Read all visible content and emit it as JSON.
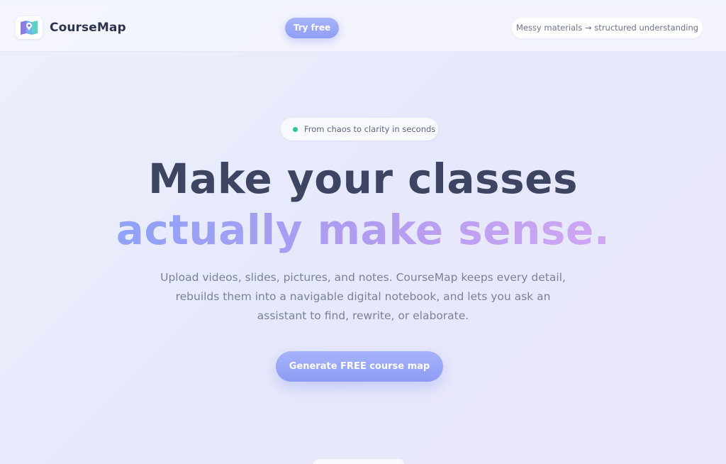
{
  "header": {
    "brand": "CourseMap",
    "try_button": "Try free",
    "tagline": "Messy materials → structured understanding",
    "logo_icon": "map-pin-icon"
  },
  "hero": {
    "badge": "From chaos to clarity in seconds",
    "headline_line1": "Make your classes",
    "headline_line2": "actually make sense.",
    "subtext": "Upload videos, slides, pictures, and notes. CourseMap keeps every detail, rebuilds them into a navigable digital notebook, and lets you ask an assistant to find, rewrite, or elaborate.",
    "cta": "Generate FREE course map"
  },
  "colors": {
    "accent": "#95a4f6",
    "accent_purple": "#d0a6f4",
    "status_dot": "#2cc793",
    "heading": "#3d4563"
  }
}
